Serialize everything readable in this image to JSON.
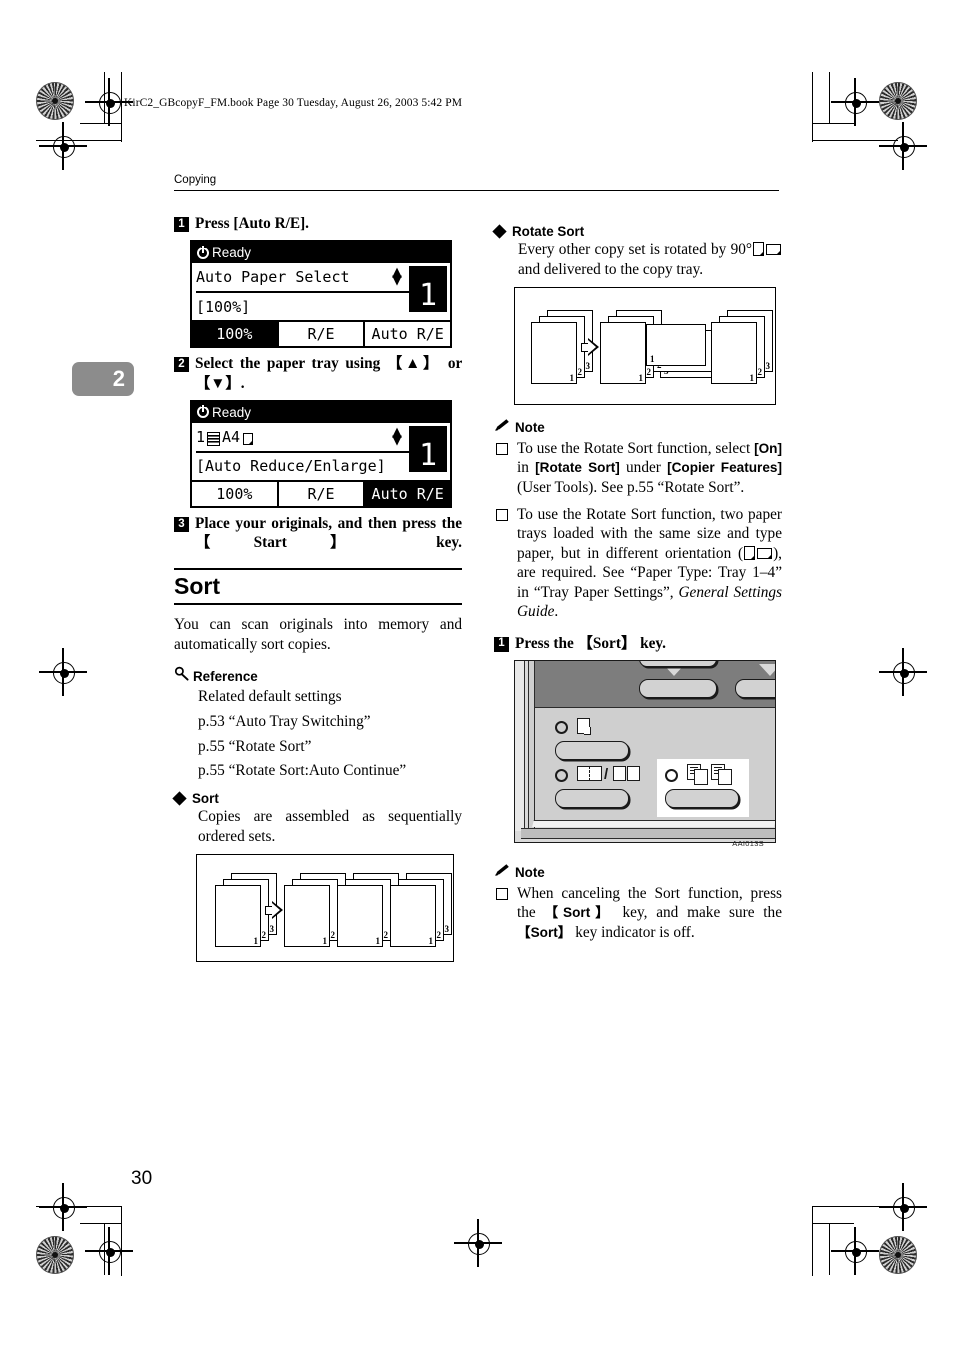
{
  "document": {
    "filestamp": "KirC2_GBcopyF_FM.book  Page 30  Tuesday, August 26, 2003  5:42 PM",
    "running_header": "Copying",
    "chapter_tab": "2",
    "page_number": "30"
  },
  "left_column": {
    "step1": {
      "number": "1",
      "text": "Press [Auto R/E]."
    },
    "lcd1": {
      "status": "Ready",
      "line1": "Auto Paper Select",
      "line2": "[100%]",
      "copy_count": "1",
      "updown_icon": "up-down-arrows",
      "tabs": [
        {
          "label": "100%",
          "selected": true
        },
        {
          "label": "R/E",
          "selected": false
        },
        {
          "label": "Auto R/E",
          "selected": false
        }
      ]
    },
    "step2": {
      "number": "2",
      "text_line1": "Select the paper tray using",
      "key_up": "【▲】",
      "text_or": "or",
      "key_down": "【▼】",
      "trailing": "."
    },
    "lcd2": {
      "status": "Ready",
      "line1_tray": "1",
      "line1_size": "A4",
      "line2": "[Auto Reduce/Enlarge]",
      "copy_count": "1",
      "tabs": [
        {
          "label": "100%",
          "selected": false
        },
        {
          "label": "R/E",
          "selected": false
        },
        {
          "label": "Auto R/E",
          "selected": true
        }
      ]
    },
    "step3": {
      "number": "3",
      "text_a": "Place your originals, and then press the",
      "key": "【Start】",
      "text_b": "key."
    },
    "section": {
      "title": "Sort",
      "body": "You can scan originals into memory and automatically sort copies."
    },
    "reference": {
      "heading": "Reference",
      "icon": "magnifier-icon",
      "lines": [
        "Related default settings",
        "p.53 “Auto Tray Switching”",
        "p.55 “Rotate Sort”",
        "p.55 “Rotate Sort:Auto Continue”"
      ]
    },
    "sort_bullet": {
      "heading": "Sort",
      "body": "Copies are assembled as sequentially ordered sets."
    },
    "sort_figure": {
      "caption": "",
      "page_labels": [
        "1",
        "2",
        "3"
      ],
      "input_stacks": 1,
      "output_stacks": 3
    }
  },
  "right_column": {
    "rotate_sort_bullet": {
      "heading": "Rotate Sort",
      "body_a": "Every other copy set is rotated by 90°",
      "body_b": "and delivered to the copy tray.",
      "orientation_icons": [
        "portrait-sheet-icon",
        "landscape-sheet-icon"
      ]
    },
    "rotate_sort_figure": {
      "page_labels": [
        "1",
        "2",
        "3"
      ],
      "input_stacks": 1,
      "output_stacks": 3,
      "rotated_stack_index": 2
    },
    "note1": {
      "heading": "Note",
      "icon": "pencil-icon",
      "items": [
        {
          "segments": [
            {
              "text": "To use the Rotate Sort function, select ",
              "style": "normal"
            },
            {
              "text": "[On]",
              "style": "bold"
            },
            {
              "text": " in ",
              "style": "normal"
            },
            {
              "text": "[Rotate Sort]",
              "style": "bold"
            },
            {
              "text": " under ",
              "style": "normal"
            },
            {
              "text": "[Copier Features]",
              "style": "bold"
            },
            {
              "text": " (User Tools). See p.55 “Rotate Sort”.",
              "style": "normal"
            }
          ]
        },
        {
          "segments": [
            {
              "text": "To use the Rotate Sort function, two paper trays loaded with the same size and type paper, but in different orientation (",
              "style": "normal"
            },
            {
              "text": "ORIENTATION_ICONS",
              "style": "icons"
            },
            {
              "text": "), are required. See “Paper Type: Tray 1–4” in “Tray Paper Settings”, ",
              "style": "normal"
            },
            {
              "text": "General Settings Guide",
              "style": "italic"
            },
            {
              "text": ".",
              "style": "normal"
            }
          ]
        }
      ]
    },
    "step1": {
      "number": "1",
      "text_a": "Press the",
      "key": "【Sort】",
      "text_b": "key."
    },
    "panel_figure": {
      "code": "AAI013S",
      "leds": [
        "combine-led",
        "duplex-led",
        "sort-led"
      ],
      "keys": [
        "combine-key",
        "duplex-key",
        "sort-key"
      ],
      "highlight": "sort-key-callout"
    },
    "note2": {
      "heading": "Note",
      "icon": "pencil-icon",
      "items": [
        {
          "segments": [
            {
              "text": "When canceling the Sort function, press the ",
              "style": "normal"
            },
            {
              "text": "【Sort】",
              "style": "bold"
            },
            {
              "text": " key, and make sure the ",
              "style": "normal"
            },
            {
              "text": "【Sort】",
              "style": "bold"
            },
            {
              "text": " key indicator is off.",
              "style": "normal"
            }
          ]
        }
      ]
    }
  },
  "colors": {
    "ink": "#000000",
    "chapter_tab_bg": "#8c8c8c",
    "panel_dark": "#7d7d7d",
    "panel_light": "#cfcfcf",
    "key_face": "#d2d2d2"
  }
}
